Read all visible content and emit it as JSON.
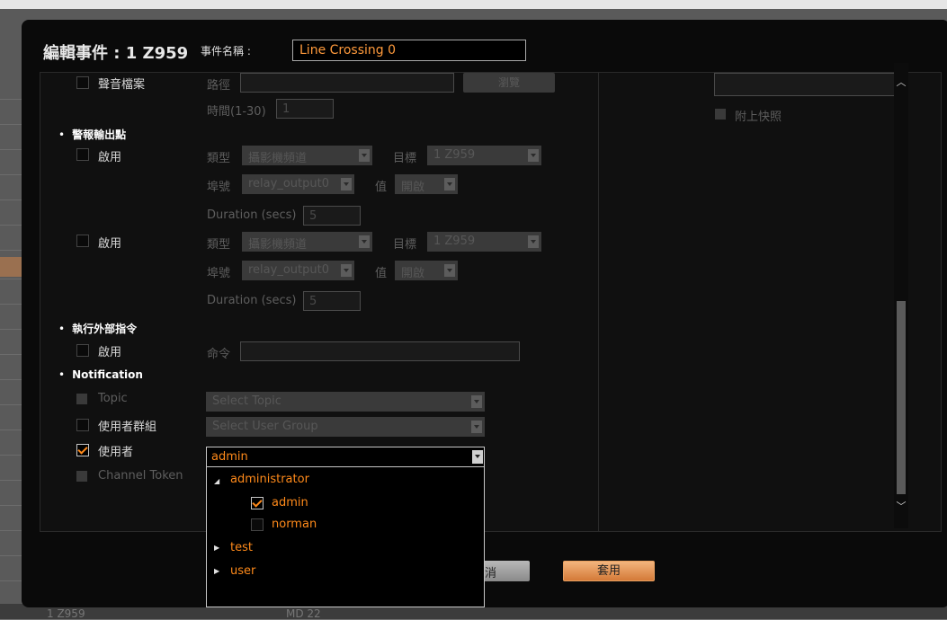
{
  "dialog": {
    "title": "編輯事件 : 1 Z959",
    "event_name_label": "事件名稱 :",
    "event_name_value": "Line Crossing 0"
  },
  "audio": {
    "label": "聲音檔案",
    "path_label": "路徑",
    "browse_label": "瀏覽",
    "time_label": "時間(1-30)",
    "time_value": "1",
    "snapshot_label": "附上快照"
  },
  "alarm_output": {
    "section": "警報輸出點",
    "rows": [
      {
        "enable_label": "啟用",
        "type_label": "類型",
        "type_value": "攝影機頻道",
        "target_label": "目標",
        "target_value": "1 Z959",
        "port_label": "埠號",
        "port_value": "relay_output0",
        "value_label": "值",
        "value_value": "開啟",
        "duration_label": "Duration (secs)",
        "duration_value": "5"
      },
      {
        "enable_label": "啟用",
        "type_label": "類型",
        "type_value": "攝影機頻道",
        "target_label": "目標",
        "target_value": "1 Z959",
        "port_label": "埠號",
        "port_value": "relay_output0",
        "value_label": "值",
        "value_value": "開啟",
        "duration_label": "Duration (secs)",
        "duration_value": "5"
      }
    ]
  },
  "external_command": {
    "section": "執行外部指令",
    "enable_label": "啟用",
    "command_label": "命令"
  },
  "notification": {
    "section": "Notification",
    "topic_label": "Topic",
    "topic_placeholder": "Select Topic",
    "user_group_label": "使用者群組",
    "user_group_placeholder": "Select User Group",
    "user_label": "使用者",
    "user_value": "admin",
    "channel_token_label": "Channel Token",
    "tree": [
      {
        "label": "administrator",
        "expanded": true,
        "children": [
          {
            "label": "admin",
            "checked": true
          },
          {
            "label": "norman",
            "checked": false
          }
        ]
      },
      {
        "label": "test",
        "expanded": false
      },
      {
        "label": "user",
        "expanded": false
      }
    ]
  },
  "footer": {
    "cancel_label": "消",
    "apply_label": "套用"
  },
  "background": {
    "bottom_left": "1 Z959",
    "bottom_mid": "MD 22"
  },
  "colors": {
    "accent": "#ff8a1a",
    "apply_button": "#e39655",
    "dialog_bg": "#0a0a0a"
  }
}
